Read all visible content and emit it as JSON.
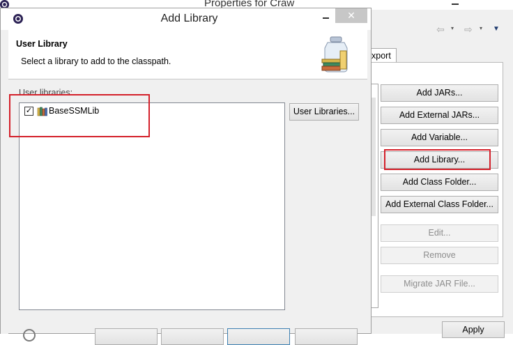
{
  "background_window": {
    "title": "Properties for Craw",
    "nav": {
      "back": "⇦",
      "forward": "⇨",
      "dropdown": "▾",
      "view_menu": "▼"
    },
    "tab_label": "xport",
    "buttons": [
      {
        "label": "Add JARs...",
        "enabled": true
      },
      {
        "label": "Add External JARs...",
        "enabled": true
      },
      {
        "label": "Add Variable...",
        "enabled": true
      },
      {
        "label": "Add Library...",
        "enabled": true,
        "highlighted": true
      },
      {
        "label": "Add Class Folder...",
        "enabled": true
      },
      {
        "label": "Add External Class Folder...",
        "enabled": true
      },
      {
        "label": "Edit...",
        "enabled": false
      },
      {
        "label": "Remove",
        "enabled": false
      },
      {
        "label": "Migrate JAR File...",
        "enabled": false
      }
    ],
    "apply_label": "Apply"
  },
  "dialog": {
    "title": "Add Library",
    "close_glyph": "✕",
    "heading": "User Library",
    "description": "Select a library to add to the classpath.",
    "list_label": "User libraries:",
    "libraries": [
      {
        "name": "BaseSSMLib",
        "checked": true
      }
    ],
    "check_glyph": "✓",
    "user_libraries_button": "User Libraries..."
  },
  "colors": {
    "highlight_red": "#d4202a",
    "dialog_bg": "#f0f0f0",
    "focus_blue": "#3c7fb1"
  }
}
